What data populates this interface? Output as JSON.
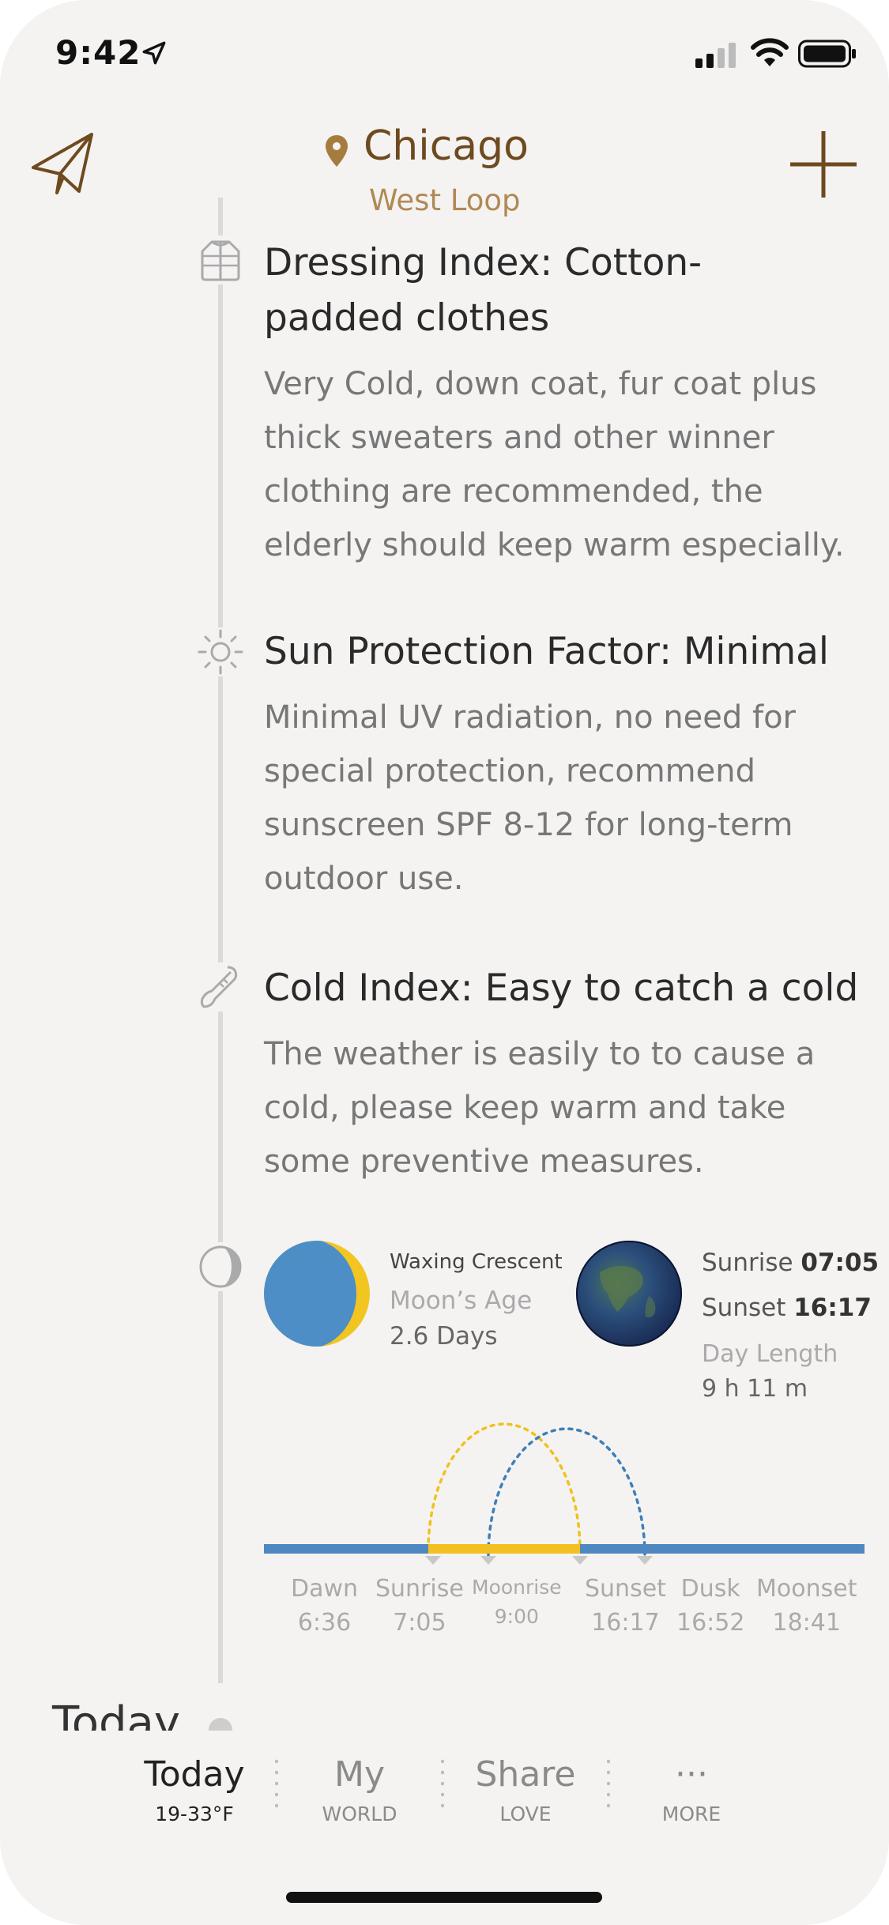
{
  "status_bar": {
    "time": "9:42"
  },
  "header": {
    "city": "Chicago",
    "district": "West Loop"
  },
  "indices": [
    {
      "title": "Dressing Index: Cotton-padded clothes",
      "title_line1": "Dressing Index: Cotton-",
      "title_line2": "padded clothes",
      "body": "Very Cold, down coat, fur coat plus thick sweaters and other winner clothing are recommended, the elderly should keep warm especially.",
      "icon": "jacket-icon"
    },
    {
      "title": "Sun Protection Factor: Minimal",
      "body": "Minimal UV radiation, no need for special protection, recommend sunscreen SPF 8-12 for long-term outdoor use.",
      "icon": "sun-icon"
    },
    {
      "title": "Cold Index: Easy to catch a cold",
      "body": "The weather is easily to to cause a cold, please keep warm and take some preventive measures.",
      "icon": "thermometer-icon"
    }
  ],
  "astro": {
    "moon": {
      "phase": "Waxing Crescent",
      "age_label": "Moon’s Age",
      "age_value": "2.6 Days",
      "illumination": 0.1
    },
    "sun": {
      "sunrise_label": "Sunrise",
      "sunrise": "07:05",
      "sunset_label": "Sunset",
      "sunset": "16:17",
      "day_length_label": "Day Length",
      "day_length": "9 h 11 m"
    },
    "timeline": [
      {
        "name": "Dawn",
        "time": "6:36"
      },
      {
        "name": "Sunrise",
        "time": "7:05"
      },
      {
        "name": "Moonrise",
        "time": "9:00"
      },
      {
        "name": "Sunset",
        "time": "16:17"
      },
      {
        "name": "Dusk",
        "time": "16:52"
      },
      {
        "name": "Moonset",
        "time": "18:41"
      }
    ]
  },
  "today_peek": {
    "label": "Today"
  },
  "tabs": [
    {
      "label": "Today",
      "sub": "19-33°F",
      "active": true
    },
    {
      "label": "My",
      "sub": "WORLD"
    },
    {
      "label": "Share",
      "sub": "LOVE"
    },
    {
      "label": "···",
      "sub": "MORE"
    }
  ],
  "colors": {
    "accent_brown": "#6e4a1e",
    "accent_gold": "#b08a54",
    "sun_arc": "#f0c21a",
    "moon_arc": "#3f7fb8",
    "axis_blue": "#4f88c0"
  }
}
